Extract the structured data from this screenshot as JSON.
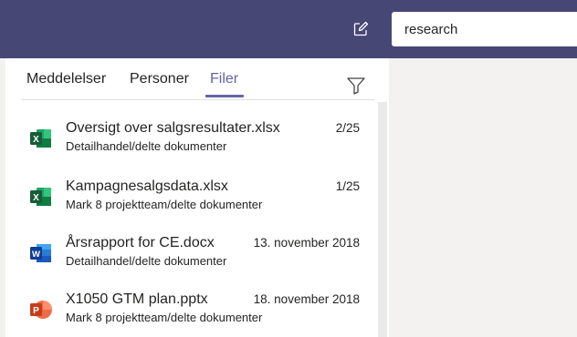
{
  "search": {
    "value": "research"
  },
  "tabs": [
    {
      "label": "Meddelelser"
    },
    {
      "label": "Personer"
    },
    {
      "label": "Filer"
    }
  ],
  "colors": {
    "header_bg": "#464775",
    "accent": "#6264a7",
    "excel": "#217346",
    "word": "#2b579a",
    "powerpoint": "#d24726"
  },
  "files": [
    {
      "icon": "excel-file-icon",
      "name": "Oversigt over salgsresultater.xlsx",
      "location": "Detailhandel/delte dokumenter",
      "date": "2/25"
    },
    {
      "icon": "excel-file-icon",
      "name": "Kampagnesalgsdata.xlsx",
      "location": "Mark 8 projektteam/delte dokumenter",
      "date": "1/25"
    },
    {
      "icon": "word-file-icon",
      "name": "Årsrapport for CE.docx",
      "location": "Detailhandel/delte dokumenter",
      "date": "13. november 2018"
    },
    {
      "icon": "powerpoint-file-icon",
      "name": "X1050 GTM plan.pptx",
      "location": "Mark 8 projektteam/delte dokumenter",
      "date": "18. november 2018"
    }
  ]
}
